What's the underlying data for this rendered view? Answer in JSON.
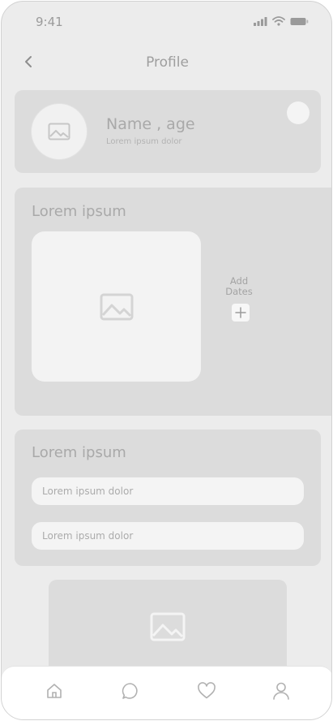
{
  "status_bar": {
    "time": "9:41"
  },
  "header": {
    "title": "Profile",
    "back_icon": "chevron-left-icon"
  },
  "profile": {
    "name": "Name , age",
    "subtitle": "Lorem ipsum dolor",
    "avatar_icon": "image-icon"
  },
  "dates_section": {
    "title": "Lorem ipsum",
    "photo_icon": "image-icon",
    "add_label": "Add Dates",
    "add_icon": "plus-icon"
  },
  "fields_section": {
    "title": "Lorem ipsum",
    "fields": [
      {
        "value": "Lorem ipsum dolor"
      },
      {
        "value": "Lorem ipsum dolor"
      }
    ]
  },
  "bottom_photo": {
    "icon": "image-icon"
  },
  "tab_bar": {
    "items": [
      {
        "icon": "home-icon"
      },
      {
        "icon": "chat-icon"
      },
      {
        "icon": "heart-icon"
      },
      {
        "icon": "user-icon"
      }
    ]
  },
  "colors": {
    "background": "#ececec",
    "card": "#dcdcdc",
    "tile": "#f3f3f3",
    "text": "#a9a9a9"
  }
}
